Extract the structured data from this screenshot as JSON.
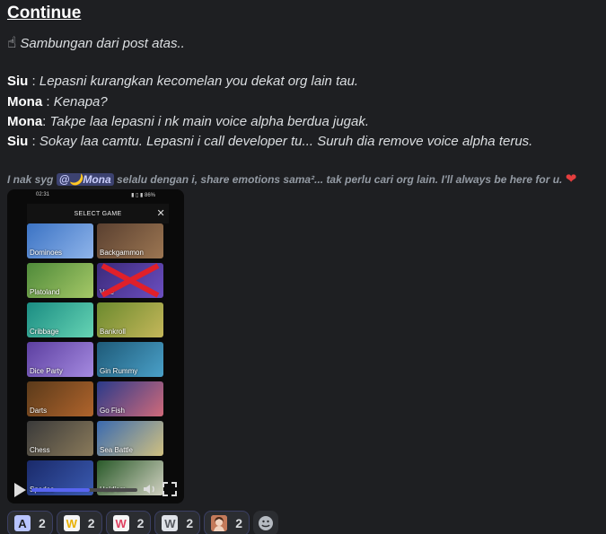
{
  "message": {
    "heading": "Continue",
    "intro_icon": "pointing-up-hand-icon",
    "intro_text": "Sambungan dari post atas..",
    "dialogue": [
      {
        "speaker": "Siu",
        "text": "Lepasni kurangkan kecomelan you dekat org lain tau."
      },
      {
        "speaker": "Mona",
        "text": "Kenapa?"
      },
      {
        "speaker": "Mona",
        "text": "Takpe laa lepasni i nk main voice alpha berdua jugak."
      },
      {
        "speaker": "Siu",
        "text": "Sokay laa camtu. Lepasni i call developer tu... Suruh dia remove voice alpha terus."
      }
    ],
    "subtext_before": "I nak syg",
    "mention": "@🌙Mona",
    "subtext_after": "selalu dengan i, share emotions sama²... tak perlu cari org lain. I'll always be here for u.",
    "heart_icon": "red-heart-icon"
  },
  "video": {
    "status_time": "02:31",
    "status_right": "▮ ▯ ▮ 86%",
    "dialog_title": "SELECT GAME",
    "games": [
      "Dominoes",
      "Backgammon",
      "Platoland",
      "Vote",
      "Cribbage",
      "Bankroll",
      "Dice Party",
      "Gin Rummy",
      "Darts",
      "Go Fish",
      "Chess",
      "Sea Battle",
      "Spades",
      "Hold'em"
    ],
    "progress": 0.55
  },
  "reactions": [
    {
      "emoji": "A",
      "count": "2"
    },
    {
      "emoji": "W",
      "count": "2"
    },
    {
      "emoji": "W",
      "count": "2"
    },
    {
      "emoji": "W",
      "count": "2"
    },
    {
      "emoji": "",
      "count": "2"
    }
  ],
  "colors": {
    "background": "#1e1f22",
    "mention_bg": "#3c4270",
    "accent": "#5865f2",
    "heart": "#e53e3e"
  }
}
